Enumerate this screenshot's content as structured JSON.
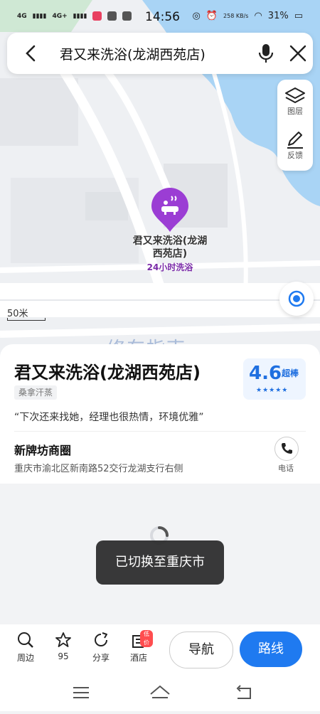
{
  "status_bar": {
    "time": "14:56",
    "signal_1": "4G",
    "signal_2": "4G+",
    "network_speed": "258 KB/s",
    "battery": "31%"
  },
  "search": {
    "query": "君又来洗浴(龙湖西苑店)"
  },
  "map_tools": {
    "layers_label": "图层",
    "feedback_label": "反馈"
  },
  "map": {
    "scale_label": "50米",
    "poi_name": "君又来洗浴(龙湖西苑店)",
    "poi_subtitle": "24小时洗浴",
    "watermark": "修车指南",
    "colors": {
      "water": "#a9d4f5",
      "pin": "#9b3dd4",
      "accent": "#1f7af0"
    }
  },
  "place": {
    "name": "君又来洗浴(龙湖西苑店)",
    "category": "桑拿汗蒸",
    "rating_score": "4.6",
    "rating_label": "超棒",
    "rating_stars": 4.5,
    "quote": "“下次还来找她，经理也很热情，环境优雅”",
    "area": "新牌坊商圈",
    "address": "重庆市渝北区新南路52交行龙湖支行右侧",
    "phone_label": "电话"
  },
  "toast": {
    "message": "已切换至重庆市"
  },
  "bottom_bar": {
    "nearby_label": "周边",
    "favorite_count": "95",
    "share_label": "分享",
    "hotel_label": "酒店",
    "hotel_tag": "低价",
    "navigate_label": "导航",
    "route_label": "路线"
  }
}
